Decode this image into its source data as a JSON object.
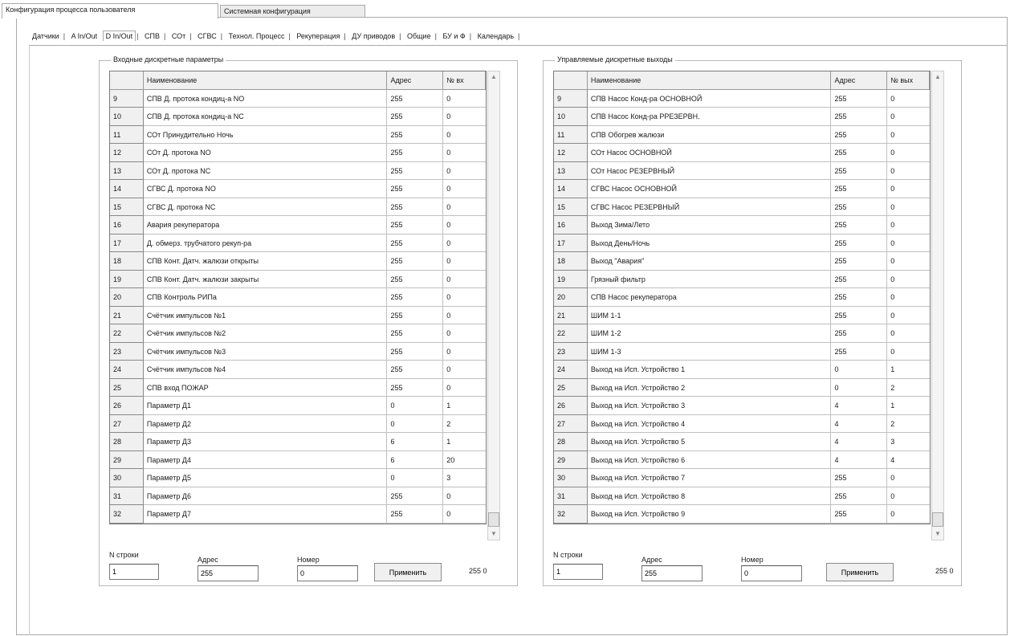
{
  "top_tabs": [
    "Конфигурация процесса пользователя",
    "Системная конфигурация"
  ],
  "sub_tabs": [
    "Датчики",
    "A In/Out",
    "D In/Out",
    "СПВ",
    "СОт",
    "СГВС",
    "Технол. Процесс",
    "Рекуперация",
    "ДУ приводов",
    "Общие",
    "БУ и Ф",
    "Календарь"
  ],
  "left_panel": {
    "title": "Входные дискретные параметры",
    "columns": [
      "",
      "Наименование",
      "Адрес",
      "№ вх"
    ],
    "rows": [
      [
        "9",
        "СПВ  Д. протока кондиц-а NO",
        "255",
        "0"
      ],
      [
        "10",
        "СПВ  Д. протока кондиц-а NC",
        "255",
        "0"
      ],
      [
        "11",
        "СОт  Принудительно Ночь",
        "255",
        "0"
      ],
      [
        "12",
        "СОт  Д. протока NO",
        "255",
        "0"
      ],
      [
        "13",
        "СОт  Д. протока NC",
        "255",
        "0"
      ],
      [
        "14",
        "СГВС  Д. протока NO",
        "255",
        "0"
      ],
      [
        "15",
        "СГВС  Д. протока NC",
        "255",
        "0"
      ],
      [
        "16",
        "Авария рекуператора",
        "255",
        "0"
      ],
      [
        "17",
        "Д. обмерз. трубчатого рекуп-ра",
        "255",
        "0"
      ],
      [
        "18",
        "СПВ Конт. Датч. жалюзи открыты",
        "255",
        "0"
      ],
      [
        "19",
        "СПВ Конт. Датч. жалюзи закрыты",
        "255",
        "0"
      ],
      [
        "20",
        "СПВ Контроль РИПа",
        "255",
        "0"
      ],
      [
        "21",
        "Счётчик импульсов №1",
        "255",
        "0"
      ],
      [
        "22",
        "Счётчик импульсов №2",
        "255",
        "0"
      ],
      [
        "23",
        "Счётчик импульсов №3",
        "255",
        "0"
      ],
      [
        "24",
        "Счётчик импульсов №4",
        "255",
        "0"
      ],
      [
        "25",
        "СПВ  вход  ПОЖАР",
        "255",
        "0"
      ],
      [
        "26",
        "Параметр Д1",
        "0",
        "1"
      ],
      [
        "27",
        "Параметр Д2",
        "0",
        "2"
      ],
      [
        "28",
        "Параметр Д3",
        "6",
        "1"
      ],
      [
        "29",
        "Параметр Д4",
        "6",
        "20"
      ],
      [
        "30",
        "Параметр Д5",
        "0",
        "3"
      ],
      [
        "31",
        "Параметр Д6",
        "255",
        "0"
      ],
      [
        "32",
        "Параметр Д7",
        "255",
        "0"
      ]
    ],
    "label_row": "N строки",
    "label_addr": "Адрес",
    "label_num": "Номер",
    "val_row": "1",
    "val_addr": "255",
    "val_num": "0",
    "apply": "Применить",
    "readout": "255  0"
  },
  "right_panel": {
    "title": "Управляемые дискретные выходы",
    "columns": [
      "",
      "Наименование",
      "Адрес",
      "№ вых"
    ],
    "rows": [
      [
        "9",
        "СПВ Насос Конд-ра ОСНОВНОЙ",
        "255",
        "0"
      ],
      [
        "10",
        "СПВ Насос Конд-ра РРЕЗЕРВН.",
        "255",
        "0"
      ],
      [
        "11",
        "СПВ Обогрев жалюзи",
        "255",
        "0"
      ],
      [
        "12",
        "СОт Насос ОСНОВНОЙ",
        "255",
        "0"
      ],
      [
        "13",
        "СОт Насос РЕЗЕРВНЫЙ",
        "255",
        "0"
      ],
      [
        "14",
        "СГВС Насос ОСНОВНОЙ",
        "255",
        "0"
      ],
      [
        "15",
        "СГВС Насос РЕЗЕРВНЫЙ",
        "255",
        "0"
      ],
      [
        "16",
        "  Выход Зима/Лето",
        "255",
        "0"
      ],
      [
        "17",
        "  Выход День/Ночь",
        "255",
        "0"
      ],
      [
        "18",
        "  Выход \"Авария\"",
        "255",
        "0"
      ],
      [
        "19",
        "Грязный фильтр",
        "255",
        "0"
      ],
      [
        "20",
        "СПВ Насос рекуператора",
        "255",
        "0"
      ],
      [
        "21",
        "ШИМ 1-1",
        "255",
        "0"
      ],
      [
        "22",
        "ШИМ 1-2",
        "255",
        "0"
      ],
      [
        "23",
        "ШИМ 1-3",
        "255",
        "0"
      ],
      [
        "24",
        "Выход на Исп. Устройство 1",
        "0",
        "1"
      ],
      [
        "25",
        "Выход на Исп. Устройство 2",
        "0",
        "2"
      ],
      [
        "26",
        "Выход на Исп. Устройство 3",
        "4",
        "1"
      ],
      [
        "27",
        "Выход на Исп. Устройство 4",
        "4",
        "2"
      ],
      [
        "28",
        "Выход на Исп. Устройство 5",
        "4",
        "3"
      ],
      [
        "29",
        "Выход на Исп. Устройство 6",
        "4",
        "4"
      ],
      [
        "30",
        "Выход на Исп. Устройство 7",
        "255",
        "0"
      ],
      [
        "31",
        "Выход на Исп. Устройство 8",
        "255",
        "0"
      ],
      [
        "32",
        "Выход на Исп. Устройство 9",
        "255",
        "0"
      ]
    ],
    "label_row": "N строки",
    "label_addr": "Адрес",
    "label_num": "Номер",
    "val_row": "1",
    "val_addr": "255",
    "val_num": "0",
    "apply": "Применить",
    "readout": "255  0"
  }
}
